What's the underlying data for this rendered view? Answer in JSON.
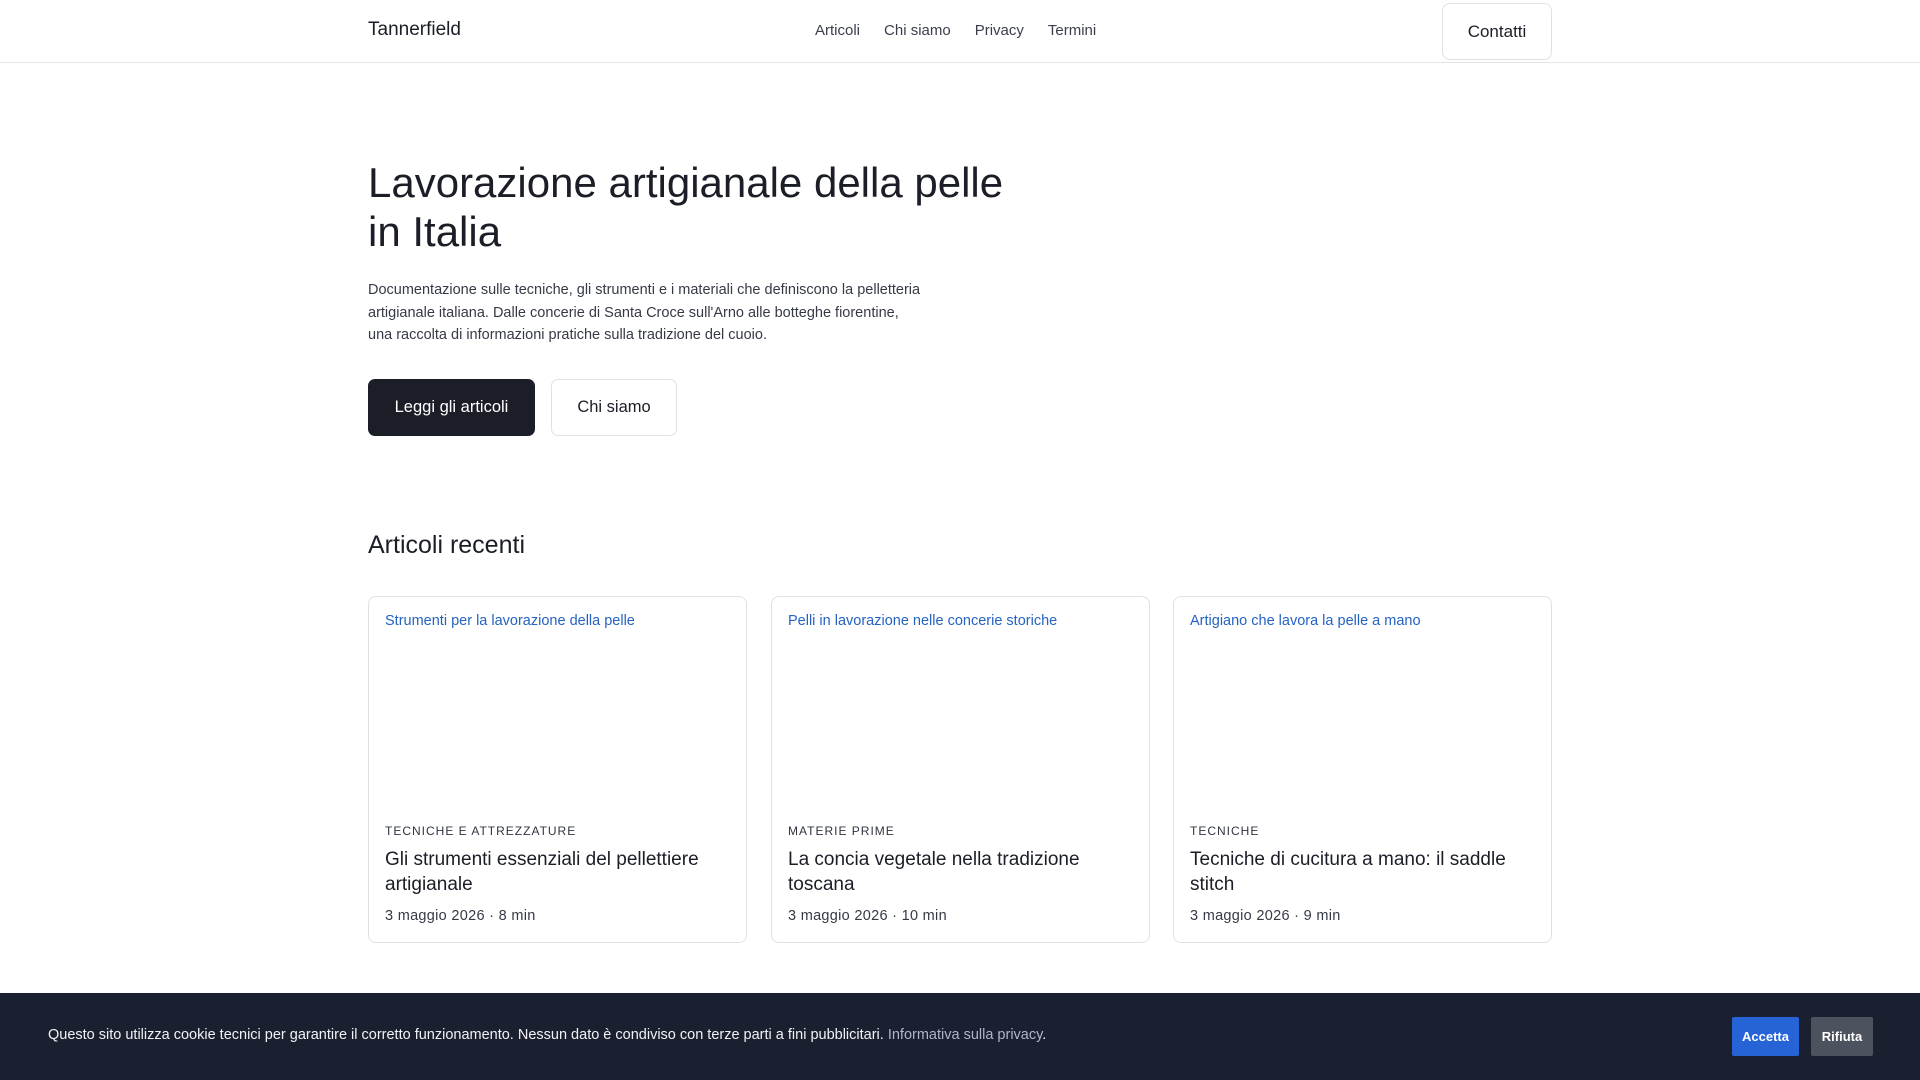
{
  "header": {
    "brand": "Tannerfield",
    "nav": [
      "Articoli",
      "Chi siamo",
      "Privacy",
      "Termini"
    ],
    "contact_label": "Contatti"
  },
  "hero": {
    "title_line1": "Lavorazione artigianale della pelle",
    "title_line2": "in Italia",
    "desc_line1": "Documentazione sulle tecniche, gli strumenti e i materiali che definiscono la pelletteria",
    "desc_line2": "artigianale italiana. Dalle concerie di Santa Croce sull'Arno alle botteghe fiorentine,",
    "desc_line3": "una raccolta di informazioni pratiche sulla tradizione del cuoio.",
    "primary_label": "Leggi gli articoli",
    "secondary_label": "Chi siamo"
  },
  "articles": {
    "section_title": "Articoli recenti",
    "items": [
      {
        "image_alt": "Strumenti per la lavorazione della pelle",
        "category": "TECNICHE E ATTREZZATURE",
        "title_line1": "Gli strumenti essenziali del pellettiere",
        "title_line2": "artigianale",
        "meta": "3 maggio 2026 · 8 min"
      },
      {
        "image_alt": "Pelli in lavorazione nelle concerie storiche",
        "category": "MATERIE PRIME",
        "title_line1": "La concia vegetale nella tradizione",
        "title_line2": "toscana",
        "meta": "3 maggio 2026 · 10 min"
      },
      {
        "image_alt": "Artigiano che lavora la pelle a mano",
        "category": "TECNICHE",
        "title_line1": "Tecniche di cucitura a mano: il saddle",
        "title_line2": "stitch",
        "meta": "3 maggio 2026 · 9 min"
      }
    ]
  },
  "cookie": {
    "text": "Questo sito utilizza cookie tecnici per garantire il corretto funzionamento. Nessun dato è condiviso con terze parti a fini pubblicitari.",
    "link_label": "Informativa sulla privacy",
    "trailing": ".",
    "accept_label": "Accetta",
    "reject_label": "Rifiuta"
  }
}
